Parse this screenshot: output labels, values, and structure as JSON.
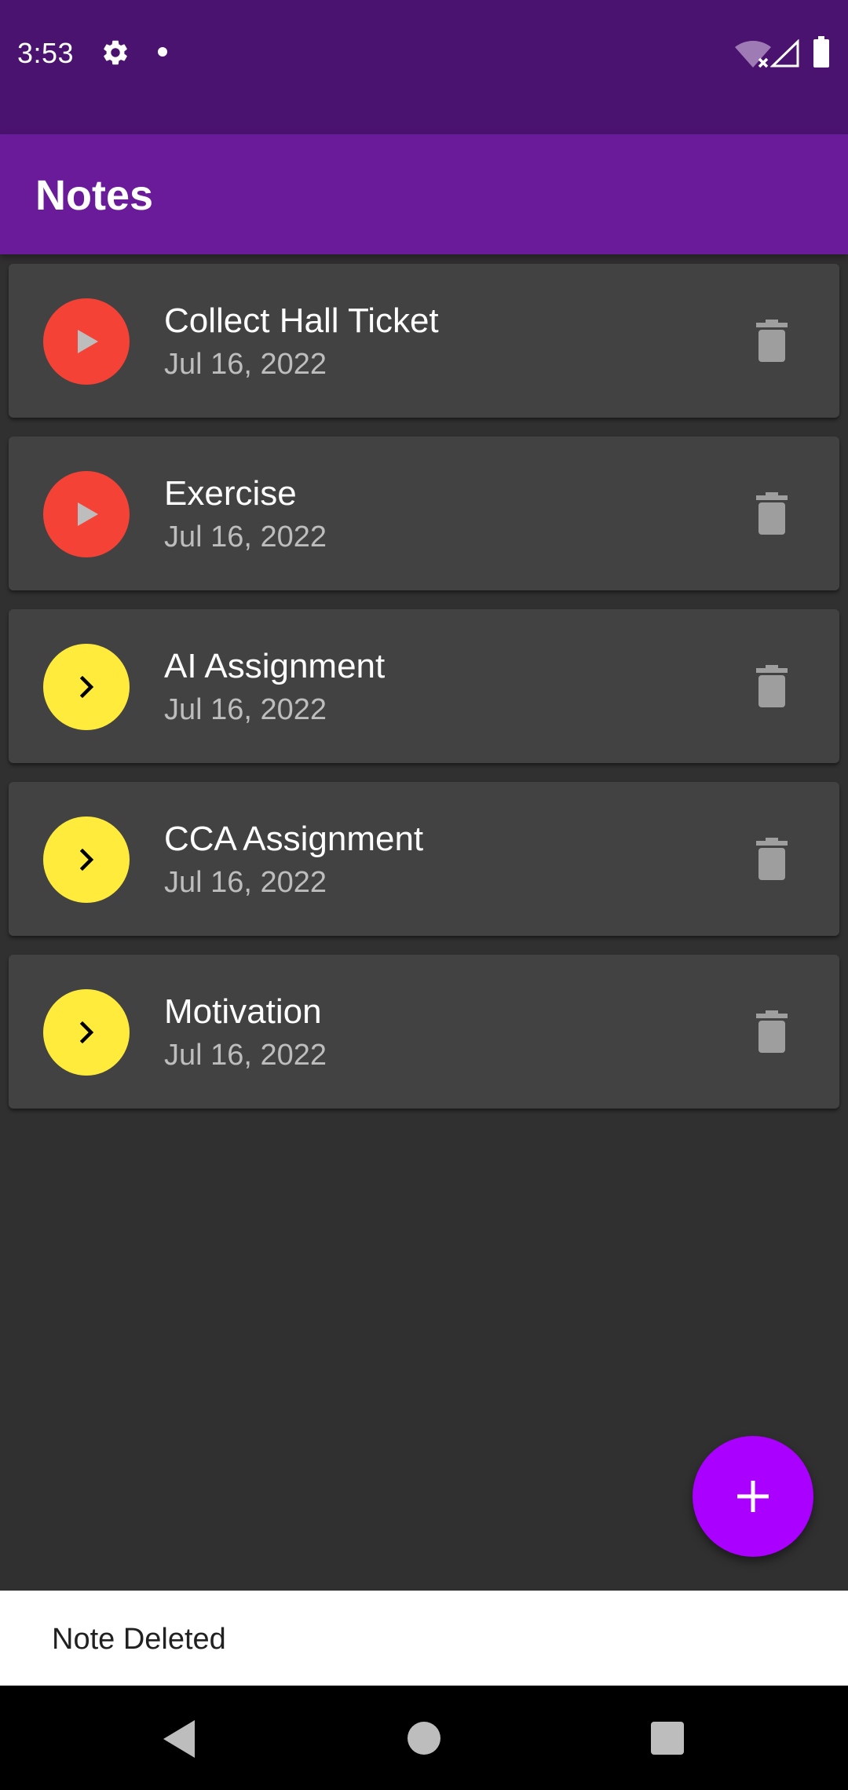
{
  "status_bar": {
    "time": "3:53",
    "icons": [
      "gear-icon",
      "notification-dot",
      "wifi-off-icon",
      "cell-signal-icon",
      "battery-icon"
    ]
  },
  "app_bar": {
    "title": "Notes",
    "color": "#6A1B9A"
  },
  "notes": [
    {
      "title": "Collect Hall Ticket",
      "date": "Jul 16, 2022",
      "icon": "play-icon",
      "icon_bg": "#F44336",
      "icon_fg": "#BDBDBD"
    },
    {
      "title": "Exercise",
      "date": "Jul 16, 2022",
      "icon": "play-icon",
      "icon_bg": "#F44336",
      "icon_fg": "#BDBDBD"
    },
    {
      "title": "AI Assignment",
      "date": "Jul 16, 2022",
      "icon": "chevron-right-icon",
      "icon_bg": "#FFEB3B",
      "icon_fg": "#000000"
    },
    {
      "title": "CCA Assignment",
      "date": "Jul 16, 2022",
      "icon": "chevron-right-icon",
      "icon_bg": "#FFEB3B",
      "icon_fg": "#000000"
    },
    {
      "title": "Motivation",
      "date": "Jul 16, 2022",
      "icon": "chevron-right-icon",
      "icon_bg": "#FFEB3B",
      "icon_fg": "#000000"
    }
  ],
  "fab": {
    "icon": "plus-icon",
    "color": "#AA00FF"
  },
  "snackbar": {
    "message": "Note Deleted"
  },
  "nav_bar": {
    "buttons": [
      "back-icon",
      "home-icon",
      "recents-icon"
    ]
  }
}
